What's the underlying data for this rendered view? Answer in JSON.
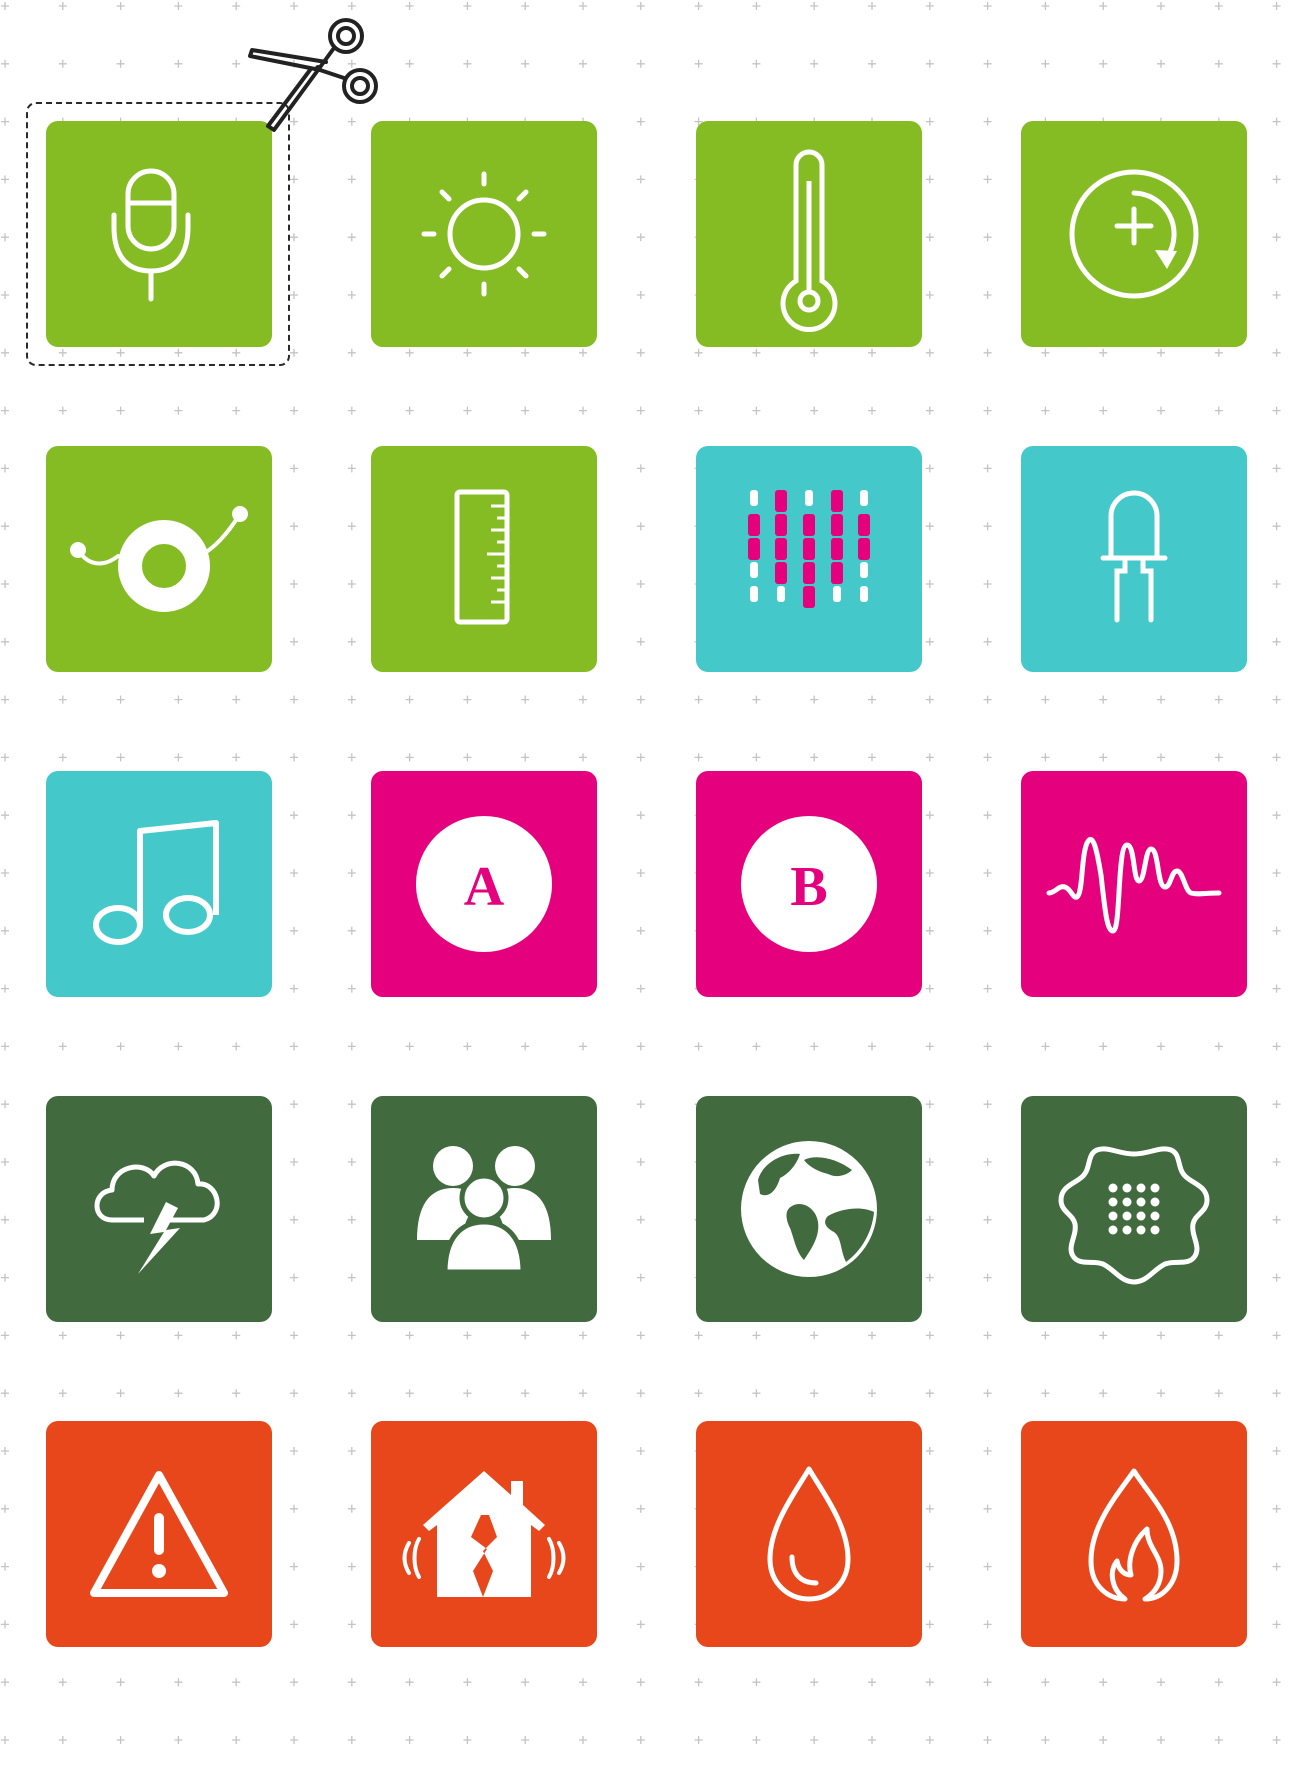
{
  "colors": {
    "background": "#ffffff",
    "grid_plus": "#c4c4c4",
    "lime": "#86bc23",
    "teal": "#45c8c9",
    "magenta": "#e5007e",
    "dark_green": "#426a3f",
    "orange": "#e8471b",
    "icon": "#ffffff",
    "scissors": "#222222"
  },
  "tiles": [
    {
      "icon": "microphone-icon",
      "color": "lime"
    },
    {
      "icon": "sun-icon",
      "color": "lime"
    },
    {
      "icon": "thermometer-icon",
      "color": "lime"
    },
    {
      "icon": "rotate-add-icon",
      "color": "lime"
    },
    {
      "icon": "eye-sensor-icon",
      "color": "lime"
    },
    {
      "icon": "ruler-icon",
      "color": "lime"
    },
    {
      "icon": "led-matrix-icon",
      "color": "teal"
    },
    {
      "icon": "led-icon",
      "color": "teal"
    },
    {
      "icon": "music-note-icon",
      "color": "teal"
    },
    {
      "icon": "button-a-icon",
      "color": "magenta",
      "label": "A"
    },
    {
      "icon": "button-b-icon",
      "color": "magenta",
      "label": "B"
    },
    {
      "icon": "sound-wave-icon",
      "color": "magenta"
    },
    {
      "icon": "thunderstorm-icon",
      "color": "dark_green"
    },
    {
      "icon": "people-icon",
      "color": "dark_green"
    },
    {
      "icon": "globe-icon",
      "color": "dark_green"
    },
    {
      "icon": "splat-grid-icon",
      "color": "dark_green"
    },
    {
      "icon": "warning-icon",
      "color": "orange"
    },
    {
      "icon": "earthquake-house-icon",
      "color": "orange"
    },
    {
      "icon": "water-drop-icon",
      "color": "orange"
    },
    {
      "icon": "fire-icon",
      "color": "orange"
    }
  ],
  "cut_outline": {
    "icon": "scissors-icon"
  }
}
